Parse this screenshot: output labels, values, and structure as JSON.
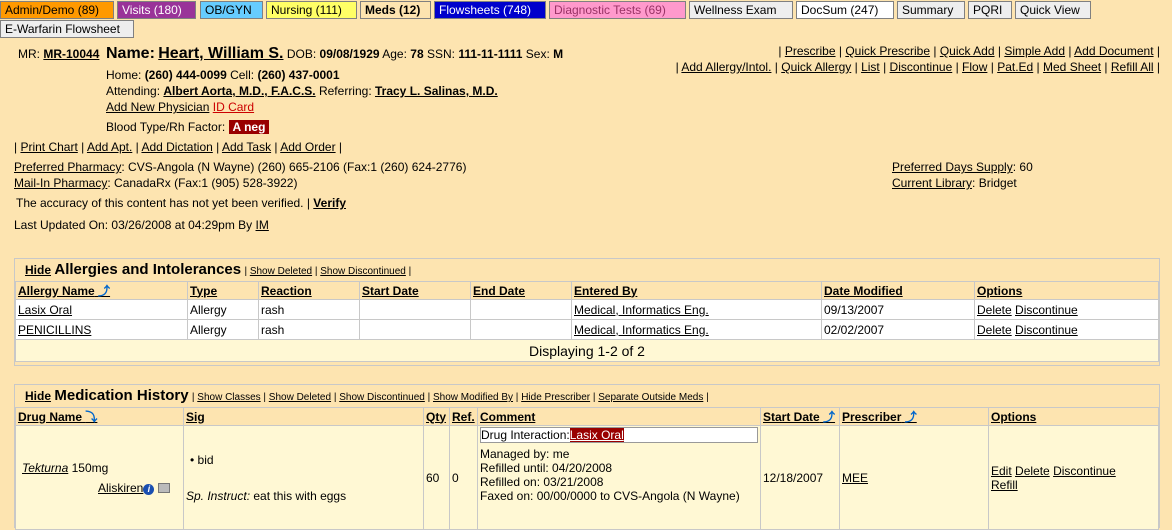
{
  "tabs": [
    {
      "label": "Admin/Demo (89)",
      "bg": "#ff9900",
      "fg": "#000000"
    },
    {
      "label": "Visits (180)",
      "bg": "#993399",
      "fg": "#ffffff"
    },
    {
      "label": "OB/GYN",
      "bg": "#66ccff",
      "fg": "#000000"
    },
    {
      "label": "Nursing (111)",
      "bg": "#ffff66",
      "fg": "#000000"
    },
    {
      "label": "Meds (12)",
      "bg": "#fde4b0",
      "fg": "#000000",
      "bold": true
    },
    {
      "label": "Flowsheets (748)",
      "bg": "#0000cc",
      "fg": "#ffffff"
    },
    {
      "label": "Diagnostic Tests (69)",
      "bg": "#ff99cc",
      "fg": "#993366"
    },
    {
      "label": "Wellness Exam",
      "bg": "#eeeeee",
      "fg": "#000000"
    },
    {
      "label": "DocSum (247)",
      "bg": "#ffffff",
      "fg": "#000000"
    },
    {
      "label": "Summary",
      "bg": "#eeeeee",
      "fg": "#000000"
    },
    {
      "label": "PQRI",
      "bg": "#eeeeee",
      "fg": "#000000"
    },
    {
      "label": "Quick View",
      "bg": "#eeeeee",
      "fg": "#000000"
    },
    {
      "label": "E-Warfarin Flowsheet",
      "bg": "#eeeeee",
      "fg": "#000000"
    }
  ],
  "patient": {
    "mr_label": "MR:",
    "mr": "MR-10044",
    "name_label": "Name:",
    "name": "Heart, William S.",
    "dob_label": "DOB:",
    "dob": "09/08/1929",
    "age_label": "Age:",
    "age": "78",
    "ssn_label": "SSN:",
    "ssn": "111-11-1111",
    "sex_label": "Sex:",
    "sex": "M",
    "home_label": "Home:",
    "home": "(260) 444-0099",
    "cell_label": "Cell:",
    "cell": "(260) 437-0001",
    "attending_label": "Attending:",
    "attending": "Albert Aorta, M.D., F.A.C.S.",
    "referring_label": "Referring:",
    "referring": "Tracy L. Salinas, M.D.",
    "add_physician": "Add New Physician",
    "id_card": "ID Card",
    "blood_label": "Blood Type/Rh Factor:",
    "blood": "A neg"
  },
  "right_links_1": [
    "Prescribe",
    "Quick Prescribe",
    "Quick Add",
    "Simple Add",
    "Add Document"
  ],
  "right_links_2": [
    "Add Allergy/Intol.",
    "Quick Allergy",
    "List",
    "Discontinue",
    "Flow",
    "Pat.Ed",
    "Med Sheet",
    "Refill All"
  ],
  "actions": [
    "Print Chart",
    "Add Apt.",
    "Add Dictation",
    "Add Task",
    "Add Order"
  ],
  "pharmacy": {
    "preferred_label": "Preferred Pharmacy",
    "preferred": "CVS-Angola (N Wayne) (260) 665-2106 (Fax:1 (260) 624-2776)",
    "mailin_label": "Mail-In Pharmacy",
    "mailin": "CanadaRx (Fax:1 (905) 528-3922)",
    "days_label": "Preferred Days Supply",
    "days": "60",
    "library_label": "Current Library",
    "library": "Bridget"
  },
  "verify_text": "The accuracy of this content has not yet been verified.",
  "verify_link": "Verify",
  "last_updated": "Last Updated On: 03/26/2008 at 04:29pm By",
  "last_updated_by": "IM",
  "allergies": {
    "hide": "Hide",
    "title": "Allergies and Intolerances",
    "links": [
      "Show Deleted",
      "Show Discontinued"
    ],
    "columns": [
      "Allergy Name",
      "Type",
      "Reaction",
      "Start Date",
      "End Date",
      "Entered By",
      "Date Modified",
      "Options"
    ],
    "rows": [
      {
        "name": "Lasix Oral",
        "type": "Allergy",
        "reaction": "rash",
        "start": "",
        "end": "",
        "entered_by": "Medical, Informatics Eng.",
        "modified": "09/13/2007"
      },
      {
        "name": "PENICILLINS",
        "type": "Allergy",
        "reaction": "rash",
        "start": "",
        "end": "",
        "entered_by": "Medical, Informatics Eng.",
        "modified": "02/02/2007"
      }
    ],
    "option_delete": "Delete",
    "option_discontinue": "Discontinue",
    "footer": "Displaying 1-2 of 2"
  },
  "medications": {
    "hide": "Hide",
    "title": "Medication History",
    "links": [
      "Show Classes",
      "Show Deleted",
      "Show Discontinued",
      "Show Modified By",
      "Hide Prescriber",
      "Separate Outside Meds"
    ],
    "columns": [
      "Drug Name",
      "Sig",
      "Qty",
      "Ref.",
      "Comment",
      "Start Date",
      "Prescriber",
      "Options"
    ],
    "row": {
      "drug": "Tekturna",
      "dose": "150mg",
      "generic": "Aliskiren",
      "sig": "bid",
      "instruct_label": "Sp. Instruct:",
      "instruct": "eat this with eggs",
      "qty": "60",
      "ref": "0",
      "interaction_label": "Drug Interaction:",
      "interaction": "Lasix Oral",
      "managed": "Managed by: me",
      "refilled_until": "Refilled until: 04/20/2008",
      "refilled_on": "Refilled on: 03/21/2008",
      "faxed": "Faxed on: 00/00/0000 to CVS-Angola (N Wayne)",
      "start": "12/18/2007",
      "prescriber": "MEE",
      "opt_edit": "Edit",
      "opt_delete": "Delete",
      "opt_discontinue": "Discontinue",
      "opt_refill": "Refill"
    }
  }
}
